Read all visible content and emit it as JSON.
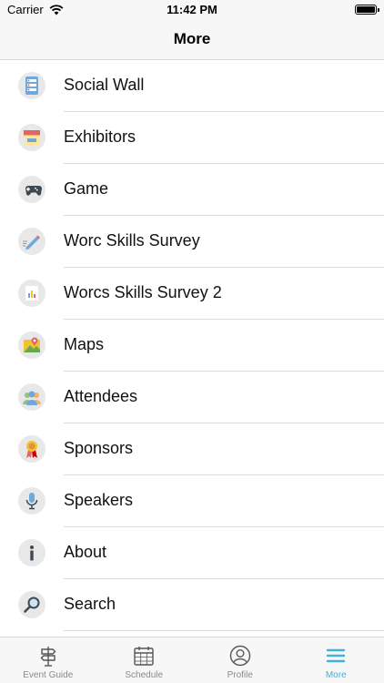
{
  "status_bar": {
    "carrier": "Carrier",
    "time": "11:42 PM"
  },
  "nav": {
    "title": "More"
  },
  "menu": {
    "items": [
      {
        "label": "Social Wall",
        "icon": "social-wall-icon"
      },
      {
        "label": "Exhibitors",
        "icon": "exhibitors-booth-icon"
      },
      {
        "label": "Game",
        "icon": "gamepad-icon"
      },
      {
        "label": "Worc Skills Survey",
        "icon": "pencil-icon"
      },
      {
        "label": "Worcs Skills Survey 2",
        "icon": "bar-chart-icon"
      },
      {
        "label": "Maps",
        "icon": "map-icon"
      },
      {
        "label": "Attendees",
        "icon": "attendees-icon"
      },
      {
        "label": "Sponsors",
        "icon": "award-ribbon-icon"
      },
      {
        "label": "Speakers",
        "icon": "microphone-icon"
      },
      {
        "label": "About",
        "icon": "info-icon"
      },
      {
        "label": "Search",
        "icon": "search-icon"
      }
    ]
  },
  "tab_bar": {
    "tabs": [
      {
        "label": "Event Guide",
        "icon": "signpost-icon",
        "active": false
      },
      {
        "label": "Schedule",
        "icon": "calendar-icon",
        "active": false
      },
      {
        "label": "Profile",
        "icon": "profile-icon",
        "active": false
      },
      {
        "label": "More",
        "icon": "hamburger-menu-icon",
        "active": true
      }
    ]
  },
  "colors": {
    "accent": "#41b3d8",
    "tab_inactive": "#555555"
  }
}
